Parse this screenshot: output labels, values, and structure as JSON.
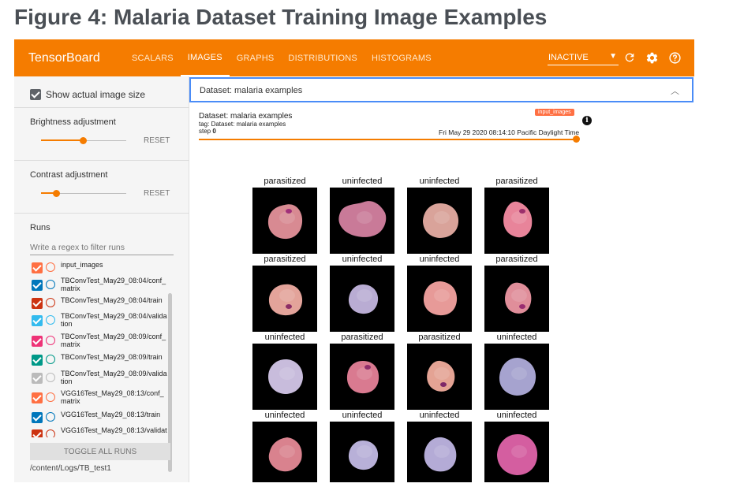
{
  "figure_title": "Figure 4: Malaria Dataset Training Image Examples",
  "topbar": {
    "brand": "TensorBoard",
    "tabs": [
      {
        "label": "SCALARS",
        "active": false
      },
      {
        "label": "IMAGES",
        "active": true
      },
      {
        "label": "GRAPHS",
        "active": false
      },
      {
        "label": "DISTRIBUTIONS",
        "active": false
      },
      {
        "label": "HISTOGRAMS",
        "active": false
      }
    ],
    "status_select": "INACTIVE",
    "icons": [
      "refresh-icon",
      "gear-icon",
      "help-icon"
    ]
  },
  "sidebar": {
    "show_actual_size": "Show actual image size",
    "brightness": {
      "label": "Brightness adjustment",
      "reset": "RESET"
    },
    "contrast": {
      "label": "Contrast adjustment",
      "reset": "RESET"
    },
    "runs_label": "Runs",
    "regex_placeholder": "Write a regex to filter runs",
    "runs": [
      {
        "name": "input_images",
        "color": "#ff7043",
        "checked": true
      },
      {
        "name": "TBConvTest_May29_08:04/conf_\nmatrix",
        "color": "#0077bb",
        "checked": true
      },
      {
        "name": "TBConvTest_May29_08:04/train",
        "color": "#cc3311",
        "checked": true
      },
      {
        "name": "TBConvTest_May29_08:04/valida\ntion",
        "color": "#33bbee",
        "checked": true
      },
      {
        "name": "TBConvTest_May29_08:09/conf_\nmatrix",
        "color": "#ee3377",
        "checked": true
      },
      {
        "name": "TBConvTest_May29_08:09/train",
        "color": "#009988",
        "checked": true
      },
      {
        "name": "TBConvTest_May29_08:09/valida\ntion",
        "color": "#bbbbbb",
        "checked": true
      },
      {
        "name": "VGG16Test_May29_08:13/conf_\nmatrix",
        "color": "#ff7043",
        "checked": true
      },
      {
        "name": "VGG16Test_May29_08:13/train",
        "color": "#0077bb",
        "checked": true
      },
      {
        "name": "VGG16Test_May29_08:13/validat",
        "color": "#cc3311",
        "checked": true
      }
    ],
    "toggle_all": "TOGGLE ALL RUNS",
    "log_dir": "/content/Logs/TB_test1"
  },
  "main": {
    "dataset_header": "Dataset: malaria examples",
    "card": {
      "title": "Dataset: malaria examples",
      "tag": "tag: Dataset: malaria examples",
      "step_label": "step ",
      "step_value": "0",
      "run_badge": "input_images",
      "timestamp": "Fri May 29 2020 08:14:10 Pacific Daylight Time"
    },
    "images": [
      {
        "label": "parasitized",
        "color": "#d88a92",
        "dot": "#a0307a"
      },
      {
        "label": "uninfected",
        "color": "#c97a98",
        "dot": ""
      },
      {
        "label": "uninfected",
        "color": "#d9a39a",
        "dot": ""
      },
      {
        "label": "parasitized",
        "color": "#e8849a",
        "dot": "#9c2f6b"
      },
      {
        "label": "parasitized",
        "color": "#e3a39a",
        "dot": "#8c2d66"
      },
      {
        "label": "uninfected",
        "color": "#b9acd3",
        "dot": ""
      },
      {
        "label": "uninfected",
        "color": "#e79a98",
        "dot": ""
      },
      {
        "label": "parasitized",
        "color": "#e08e9a",
        "dot": "#9a2d70"
      },
      {
        "label": "uninfected",
        "color": "#c8bcdc",
        "dot": ""
      },
      {
        "label": "parasitized",
        "color": "#d97a90",
        "dot": "#8e2d6a"
      },
      {
        "label": "parasitized",
        "color": "#e4a394",
        "dot": "#7d2768"
      },
      {
        "label": "uninfected",
        "color": "#a6a3cf",
        "dot": ""
      },
      {
        "label": "uninfected",
        "color": "#d9828e",
        "dot": ""
      },
      {
        "label": "uninfected",
        "color": "#b8b0d8",
        "dot": ""
      },
      {
        "label": "uninfected",
        "color": "#b4abd6",
        "dot": ""
      },
      {
        "label": "uninfected",
        "color": "#d45ea0",
        "dot": ""
      }
    ]
  }
}
